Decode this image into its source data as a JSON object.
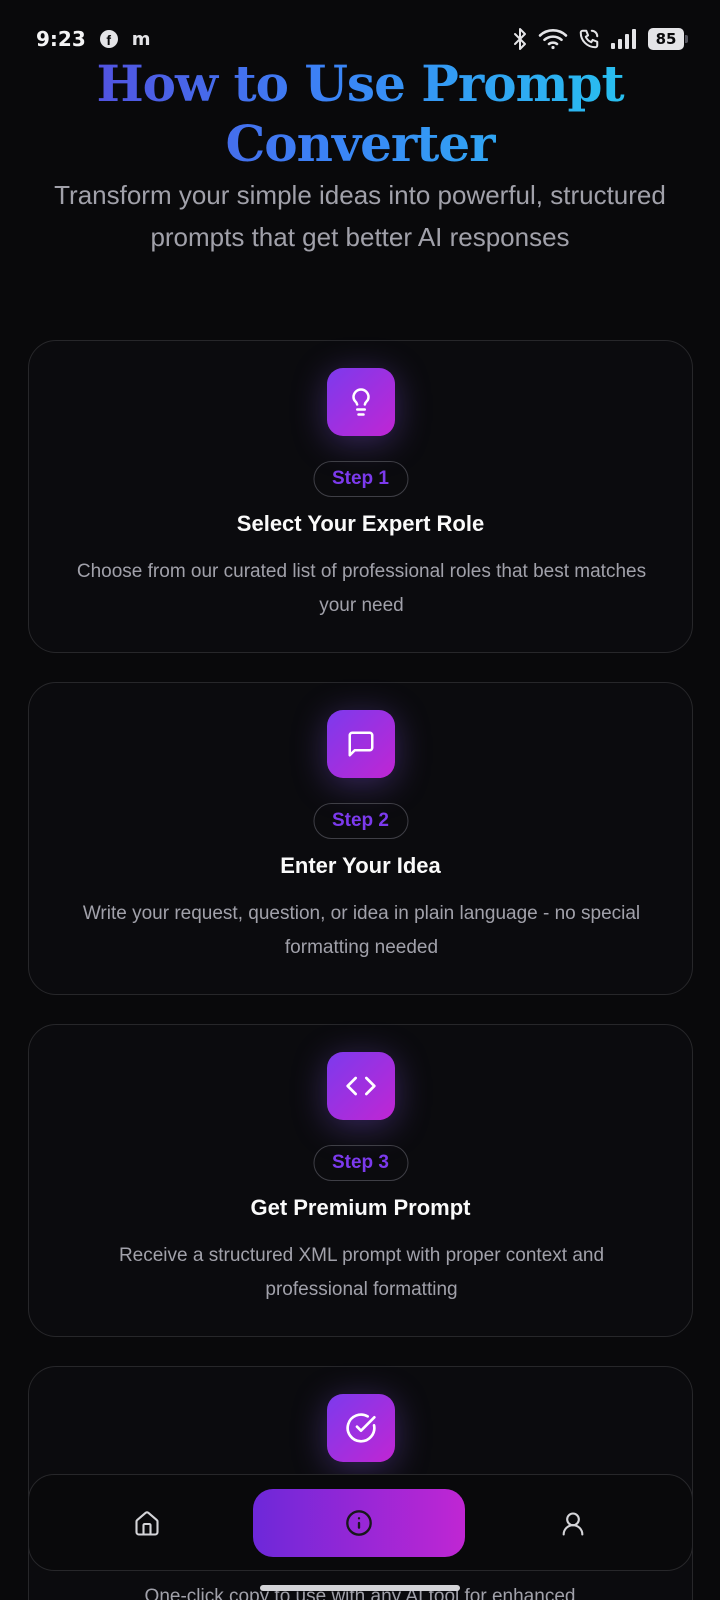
{
  "status_bar": {
    "time": "9:23",
    "app_letter": "m",
    "battery": "85"
  },
  "hero": {
    "title_line1": "How to Use Prompt",
    "title_line2": "Converter",
    "subtitle": "Transform your simple ideas into powerful, structured prompts that get better AI responses"
  },
  "steps": [
    {
      "icon": "lightbulb-icon",
      "badge": "Step 1",
      "title": "Select Your Expert Role",
      "description": "Choose from our curated list of professional roles that best matches your need"
    },
    {
      "icon": "message-square-icon",
      "badge": "Step 2",
      "title": "Enter Your Idea",
      "description": "Write your request, question, or idea in plain language - no special formatting needed"
    },
    {
      "icon": "code-icon",
      "badge": "Step 3",
      "title": "Get Premium Prompt",
      "description": "Receive a structured XML prompt with proper context and professional formatting"
    },
    {
      "icon": "check-circle-icon",
      "description_peek": "One-click copy to use with any AI tool for enhanced"
    }
  ],
  "bottom_nav": {
    "items": [
      "home-icon",
      "info-icon",
      "user-icon"
    ],
    "active": "info-icon"
  },
  "colors": {
    "background": "#09090b",
    "accent_start": "#7c3aed",
    "accent_end": "#c026d3",
    "card_border": "#27272a"
  }
}
